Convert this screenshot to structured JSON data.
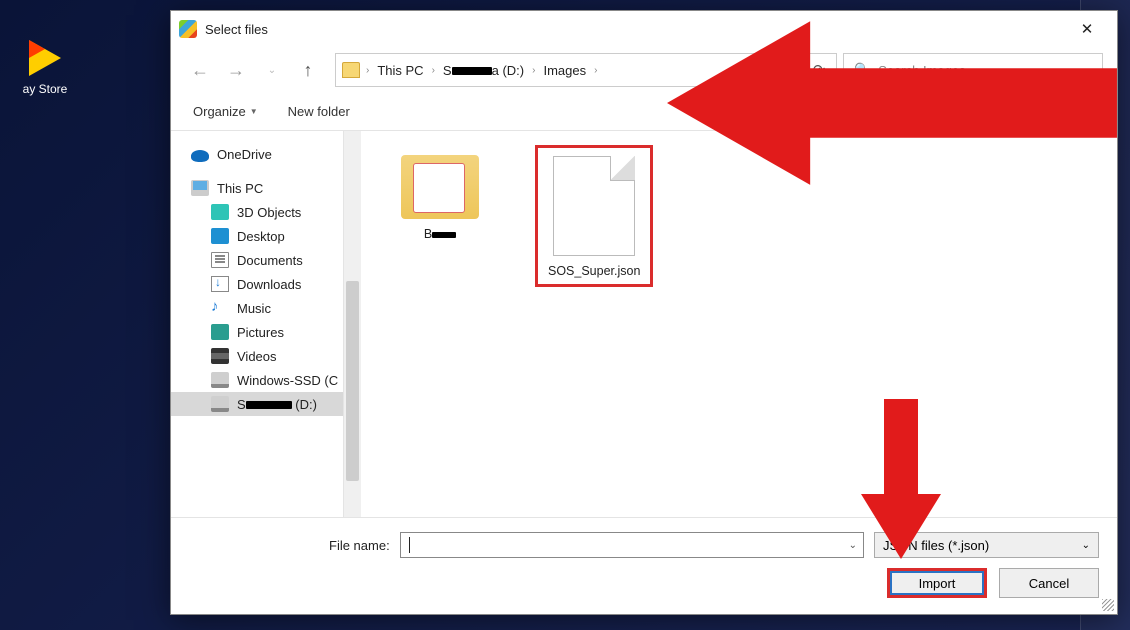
{
  "desktop": {
    "play_store_label": "ay Store"
  },
  "dialog": {
    "title": "Select files",
    "breadcrumb": {
      "root": "This PC",
      "drive": "(D:)",
      "folder": "Images"
    },
    "search_placeholder": "Search Images",
    "toolbar": {
      "organize": "Organize",
      "new_folder": "New folder"
    }
  },
  "sidebar": {
    "onedrive": "OneDrive",
    "thispc": "This PC",
    "items": [
      "3D Objects",
      "Desktop",
      "Documents",
      "Downloads",
      "Music",
      "Pictures",
      "Videos",
      "Windows-SSD (C"
    ],
    "selected_drive": "(D:)"
  },
  "files": {
    "file_json": "SOS_Super.json"
  },
  "footer": {
    "file_name_label": "File name:",
    "file_type": "JSON files (*.json)",
    "import": "Import",
    "cancel": "Cancel"
  }
}
